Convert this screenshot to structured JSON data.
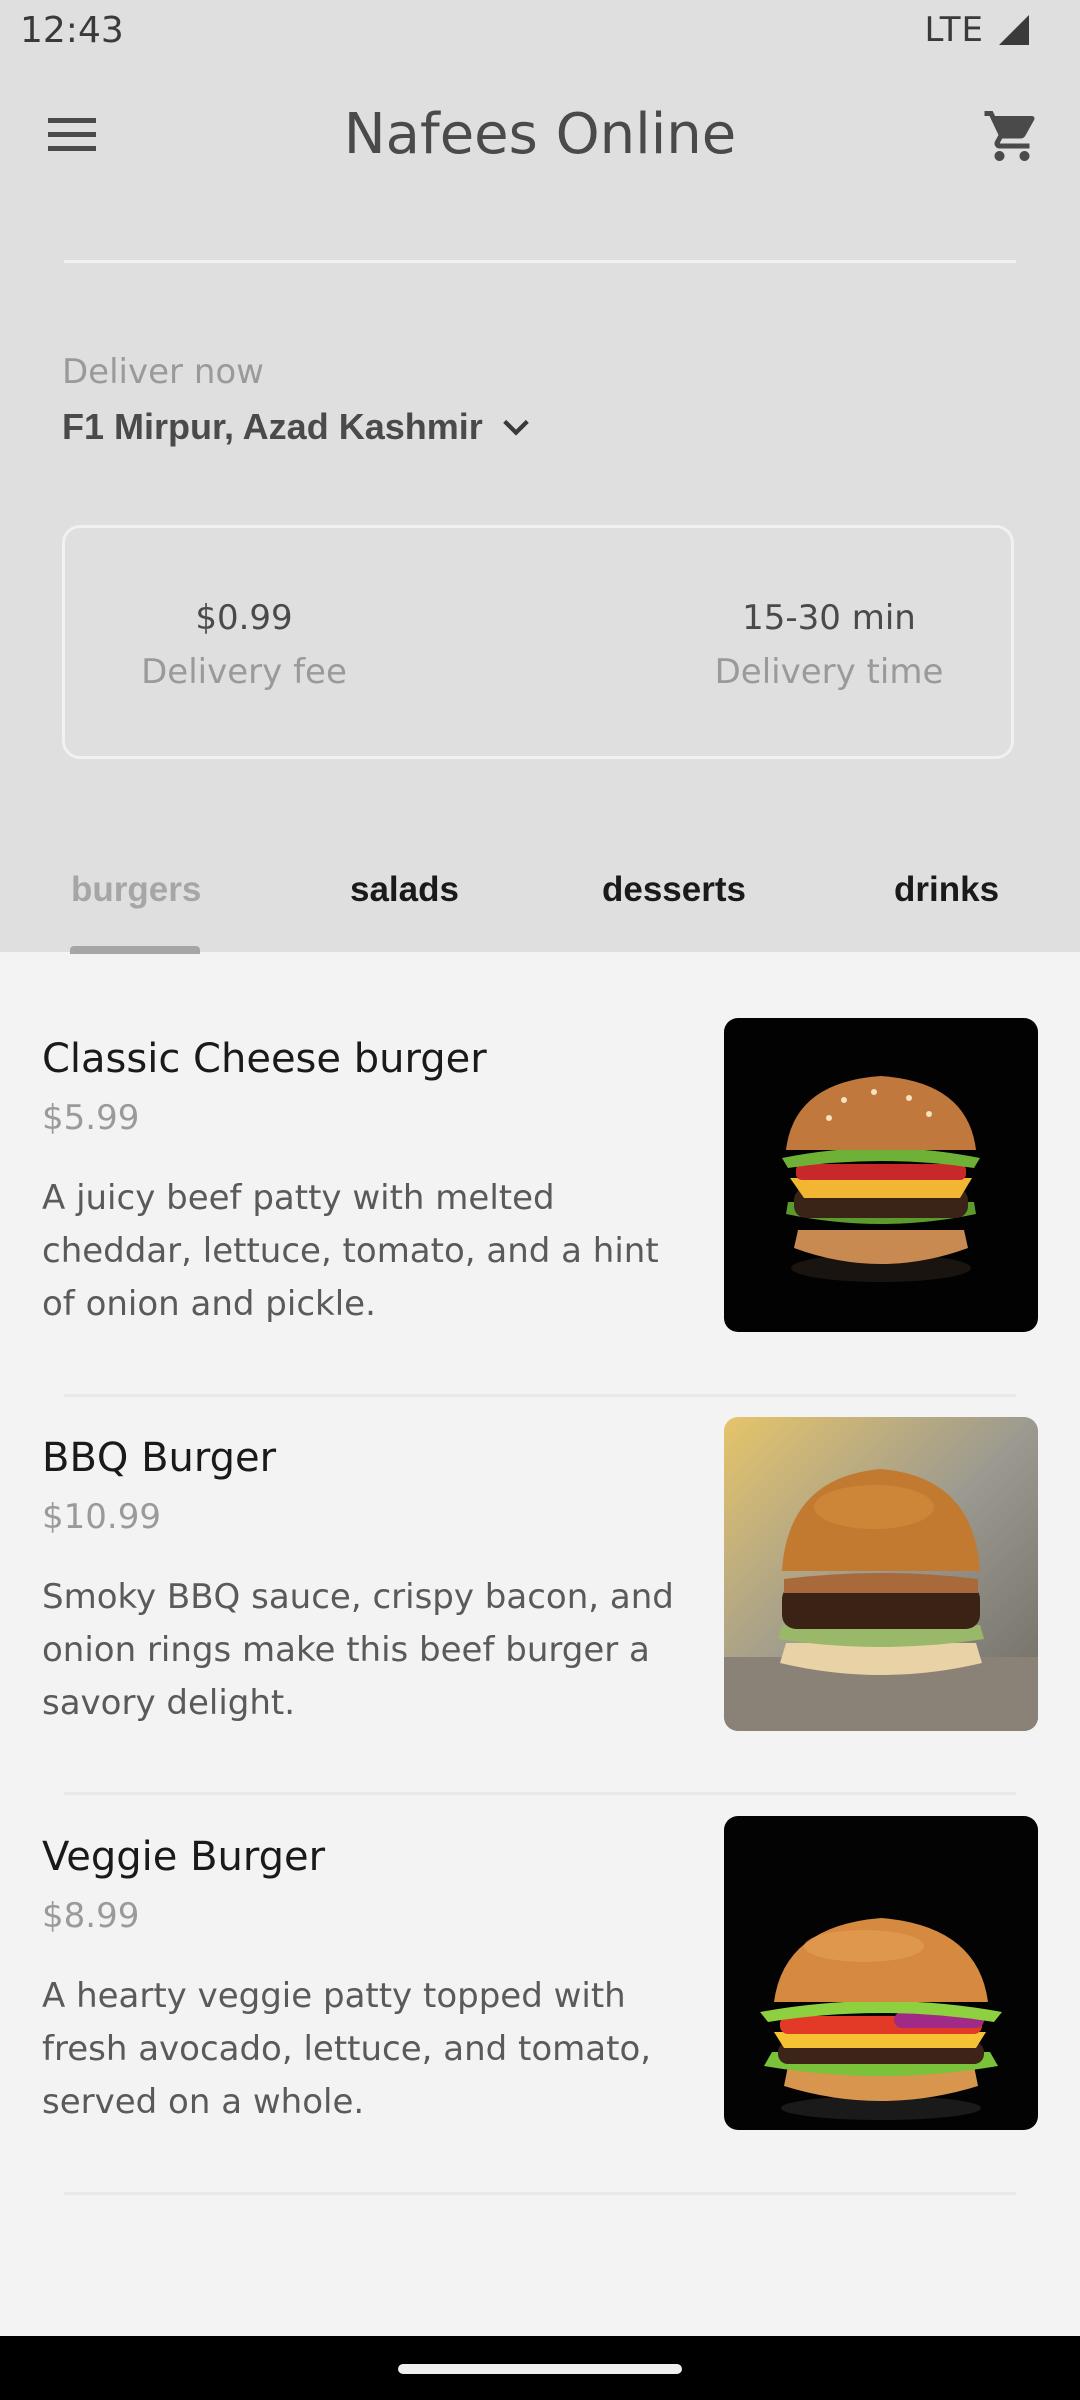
{
  "status_bar": {
    "time": "12:43",
    "network": "LTE"
  },
  "app_bar": {
    "title": "Nafees Online",
    "menu_icon": "menu-icon",
    "cart_icon": "cart-icon"
  },
  "delivery": {
    "label": "Deliver now",
    "location": "F1 Mirpur, Azad Kashmir",
    "fee_value": "$0.99",
    "fee_label": "Delivery fee",
    "time_value": "15-30 min",
    "time_label": "Delivery time"
  },
  "tabs": [
    {
      "label": "burgers",
      "active": true
    },
    {
      "label": "salads",
      "active": false
    },
    {
      "label": "desserts",
      "active": false
    },
    {
      "label": "drinks",
      "active": false
    }
  ],
  "menu_items": [
    {
      "name": "Classic Cheese burger",
      "price": "$5.99",
      "description": "A juicy beef patty with melted cheddar, lettuce, tomato, and a hint of onion and pickle."
    },
    {
      "name": "BBQ Burger",
      "price": "$10.99",
      "description": "Smoky BBQ sauce, crispy bacon, and onion rings make this beef burger a savory delight."
    },
    {
      "name": "Veggie Burger",
      "price": "$8.99",
      "description": "A hearty veggie patty topped with fresh avocado, lettuce, and tomato, served on a whole."
    }
  ],
  "colors": {
    "header_bg": "#dfdfdf",
    "list_bg": "#f3f3f3",
    "active_tab": "#a6a6a6"
  }
}
